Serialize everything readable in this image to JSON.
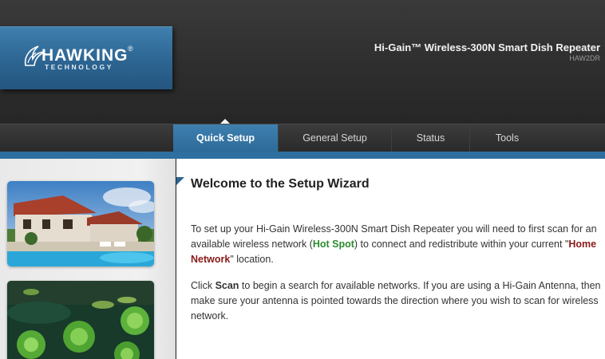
{
  "brand": {
    "name": "HAWKING",
    "registered": "®",
    "tagline": "TECHNOLOGY"
  },
  "product": {
    "title": "Hi-Gain™ Wireless-300N Smart Dish Repeater",
    "model": "HAW2DR"
  },
  "nav": {
    "items": [
      {
        "label": "Quick Setup",
        "active": true
      },
      {
        "label": "General Setup",
        "active": false
      },
      {
        "label": "Status",
        "active": false
      },
      {
        "label": "Tools",
        "active": false
      }
    ]
  },
  "main": {
    "title": "Welcome to the Setup Wizard",
    "p1": {
      "a": "To set up your Hi-Gain Wireless-300N Smart Dish Repeater you will need to first scan for an available wireless network (",
      "hot": "Hot Spot",
      "b": ") to connect and redistribute within your current \"",
      "home": "Home Network",
      "c": "\" location."
    },
    "p2": {
      "a": "Click ",
      "scan": "Scan",
      "b": " to begin a search for available networks. If you are using a Hi-Gain Antenna, then make sure your antenna is pointed towards the direction where you wish to scan for wireless network."
    }
  },
  "colors": {
    "accent_blue": "#2d6592",
    "hot_spot_green": "#2e8b2e",
    "home_network_red": "#8b1a1a"
  }
}
